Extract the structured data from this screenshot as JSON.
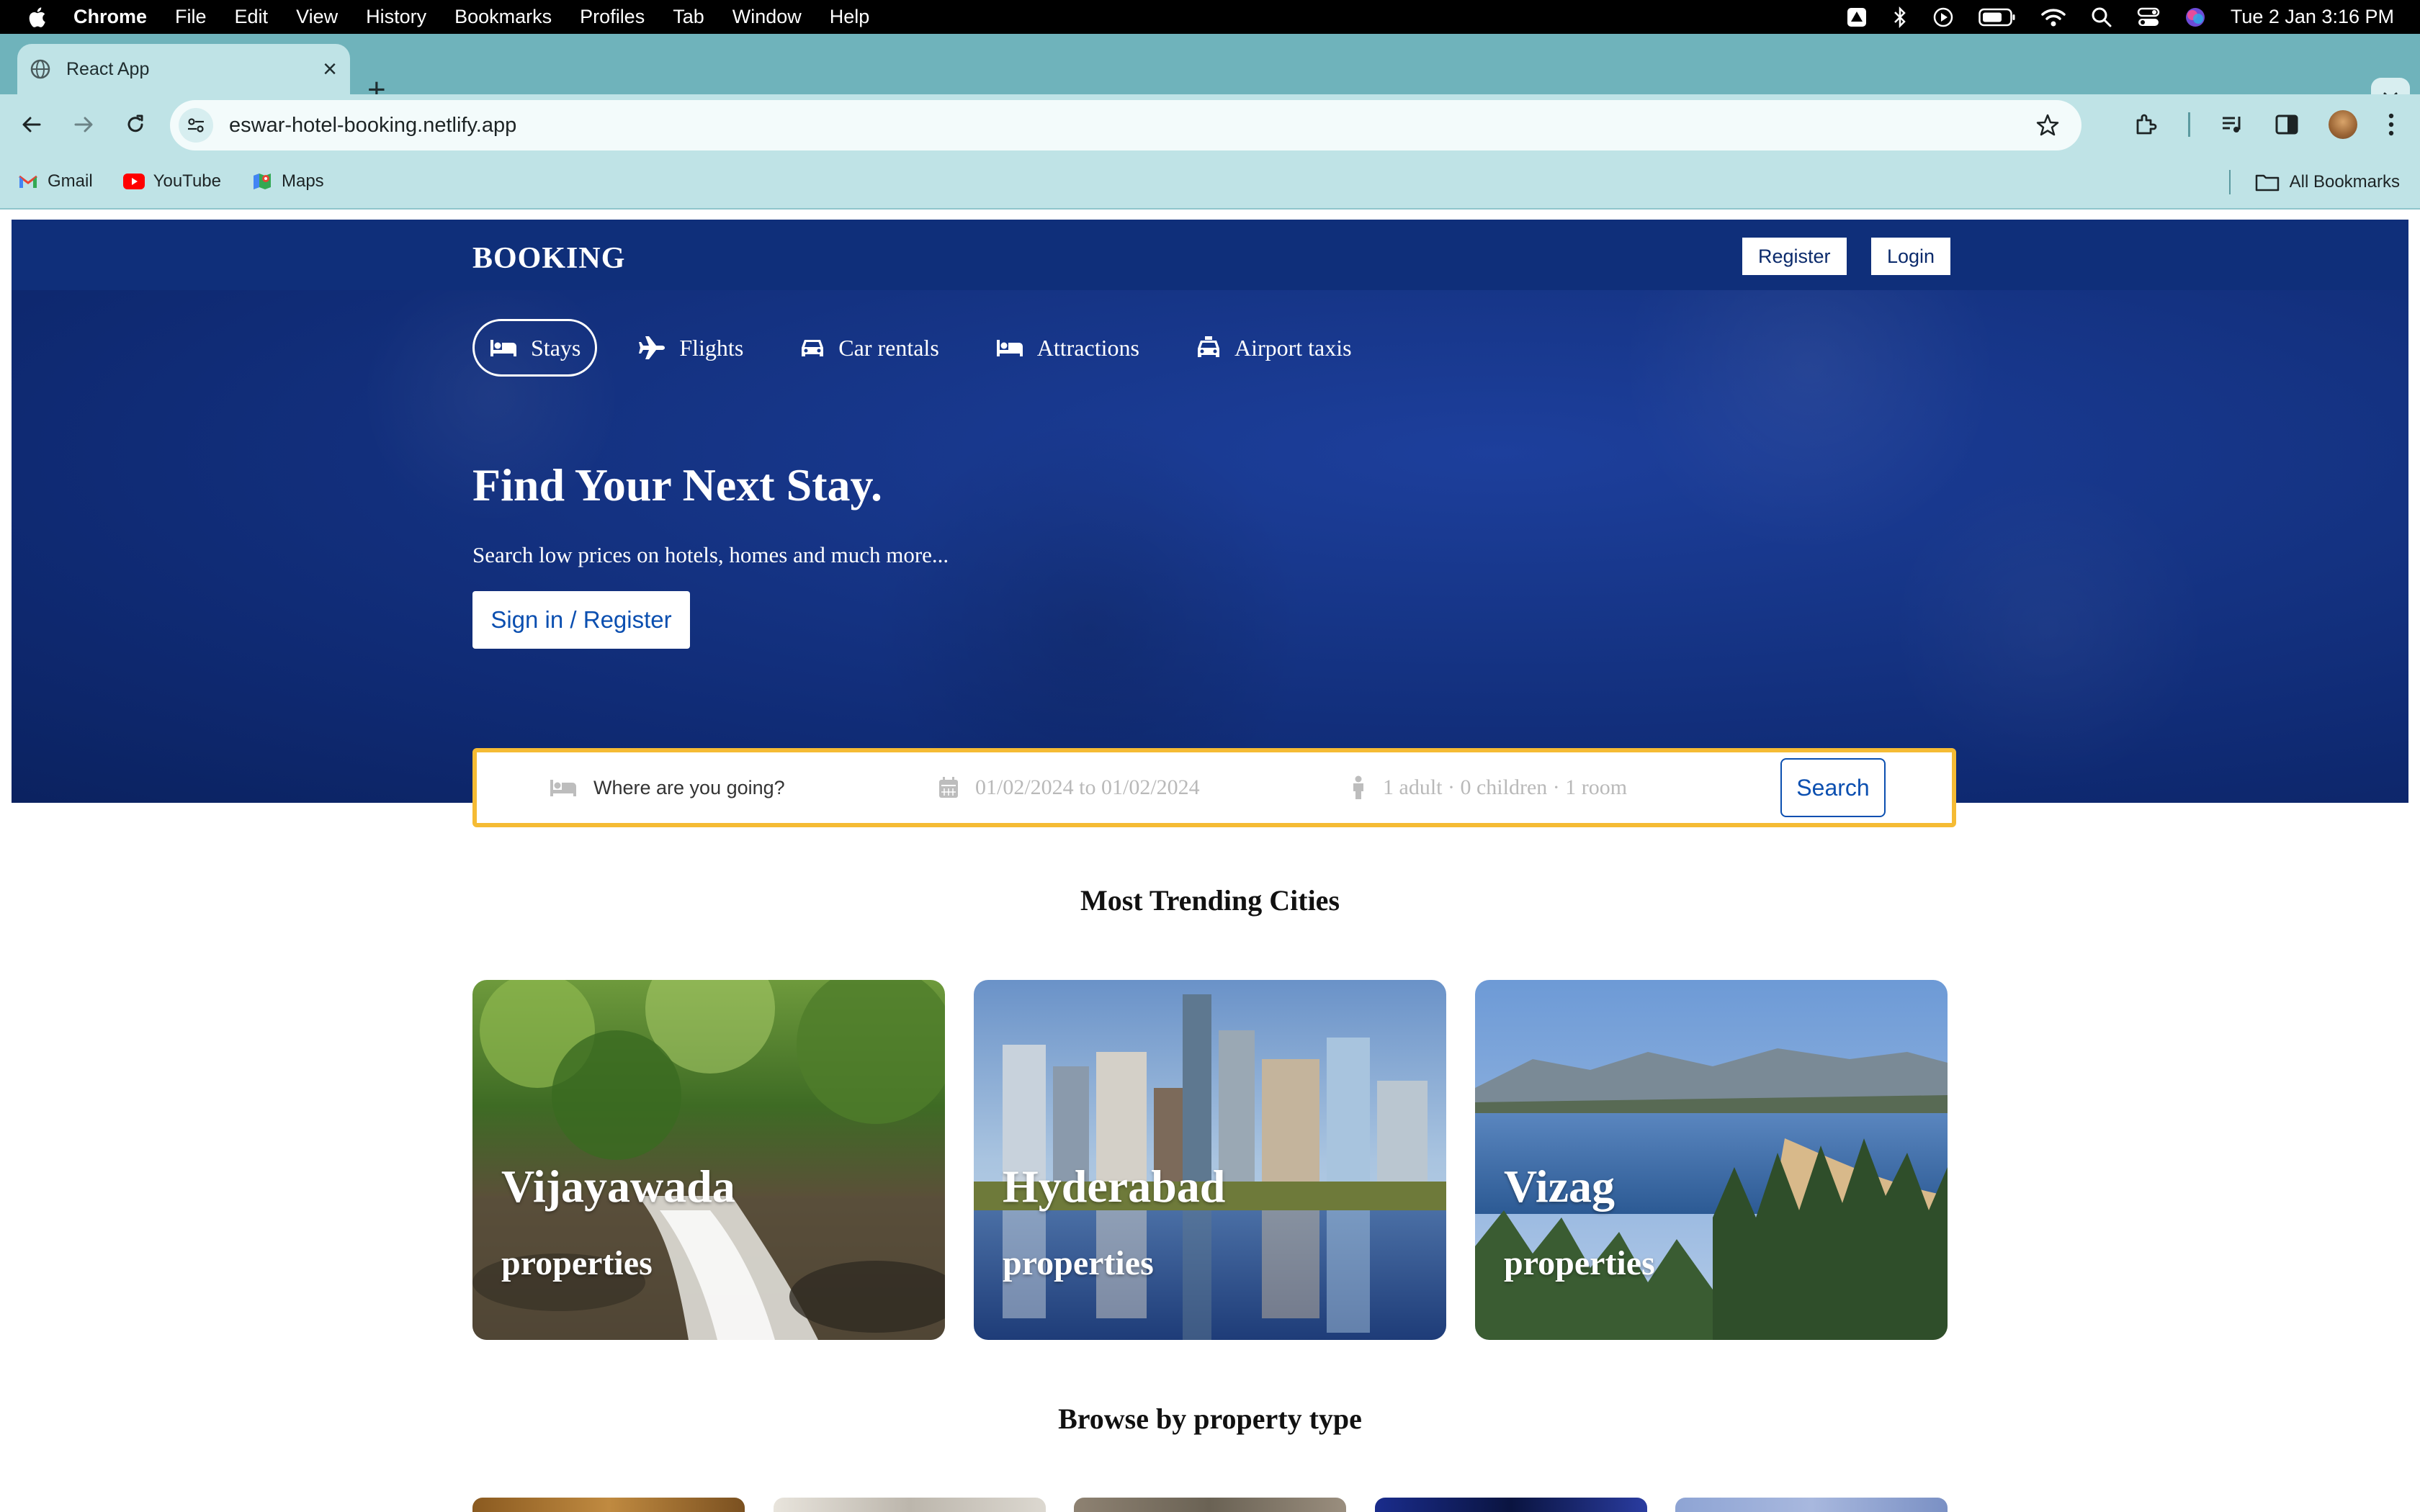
{
  "menubar": {
    "app": "Chrome",
    "items": [
      "File",
      "Edit",
      "View",
      "History",
      "Bookmarks",
      "Profiles",
      "Tab",
      "Window",
      "Help"
    ],
    "clock": "Tue 2 Jan  3:16 PM"
  },
  "browser": {
    "tab_title": "React App",
    "url": "eswar-hotel-booking.netlify.app",
    "bookmarks": [
      "Gmail",
      "YouTube",
      "Maps"
    ],
    "all_bookmarks": "All Bookmarks"
  },
  "site": {
    "logo": "BOOKING",
    "register_label": "Register",
    "login_label": "Login",
    "modes": [
      "Stays",
      "Flights",
      "Car rentals",
      "Attractions",
      "Airport taxis"
    ],
    "hero_title": "Find Your Next Stay.",
    "hero_subtitle": "Search low prices on hotels, homes and much more...",
    "hero_button": "Sign in / Register",
    "search": {
      "destination_placeholder": "Where are you going?",
      "dates": "01/02/2024 to 01/02/2024",
      "guests": "1 adult · 0 children · 1 room",
      "button": "Search"
    },
    "trending_title": "Most Trending Cities",
    "cities": [
      {
        "name": "Vijayawada",
        "label": "properties"
      },
      {
        "name": "Hyderabad",
        "label": "properties"
      },
      {
        "name": "Vizag",
        "label": "properties"
      }
    ],
    "property_type_title": "Browse by property type"
  },
  "colors": {
    "brand_navy": "#0f2f7a",
    "search_border": "#f5bb34",
    "link_blue": "#0b4fb0"
  }
}
